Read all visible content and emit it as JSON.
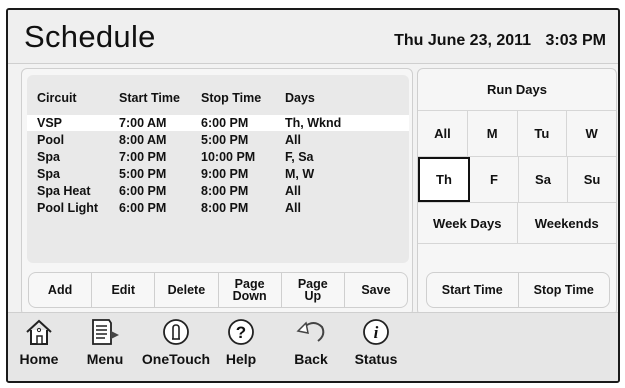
{
  "header": {
    "title": "Schedule",
    "date": "Thu June 23, 2011",
    "time": "3:03 PM"
  },
  "schedule_table": {
    "headers": [
      "Circuit",
      "Start Time",
      "Stop Time",
      "Days"
    ],
    "rows": [
      {
        "circuit": "VSP",
        "start": "7:00 AM",
        "stop": "6:00 PM",
        "days": "Th, Wknd",
        "selected": true
      },
      {
        "circuit": "Pool",
        "start": "8:00 AM",
        "stop": "5:00 PM",
        "days": "All"
      },
      {
        "circuit": "Spa",
        "start": "7:00 PM",
        "stop": "10:00 PM",
        "days": "F, Sa"
      },
      {
        "circuit": "Spa",
        "start": "5:00 PM",
        "stop": "9:00 PM",
        "days": "M, W"
      },
      {
        "circuit": "Spa Heat",
        "start": "6:00 PM",
        "stop": "8:00 PM",
        "days": "All"
      },
      {
        "circuit": "Pool Light",
        "start": "6:00 PM",
        "stop": "8:00 PM",
        "days": "All"
      }
    ]
  },
  "actions": {
    "add": "Add",
    "edit": "Edit",
    "delete": "Delete",
    "page_down_1": "Page",
    "page_down_2": "Down",
    "page_up_1": "Page",
    "page_up_2": "Up",
    "save": "Save"
  },
  "run_days": {
    "title": "Run Days",
    "row1": [
      "All",
      "M",
      "Tu",
      "W"
    ],
    "row2": [
      "Th",
      "F",
      "Sa",
      "Su"
    ],
    "selected": "Th",
    "week_days": "Week Days",
    "weekends": "Weekends",
    "start_time": "Start Time",
    "stop_time": "Stop Time"
  },
  "nav": {
    "home": "Home",
    "menu": "Menu",
    "onetouch": "OneTouch",
    "help": "Help",
    "back": "Back",
    "status": "Status"
  },
  "icons": [
    "home-icon",
    "menu-icon",
    "onetouch-icon",
    "help-icon",
    "back-icon",
    "status-icon"
  ],
  "colors": {
    "screen_bg": "#f2f2f2",
    "panel_bg": "#f6f6f6",
    "table_bg": "#e9e9e9",
    "selected_row": "#ffffff",
    "nav_bg": "#e6e6e6",
    "text": "#111111"
  }
}
